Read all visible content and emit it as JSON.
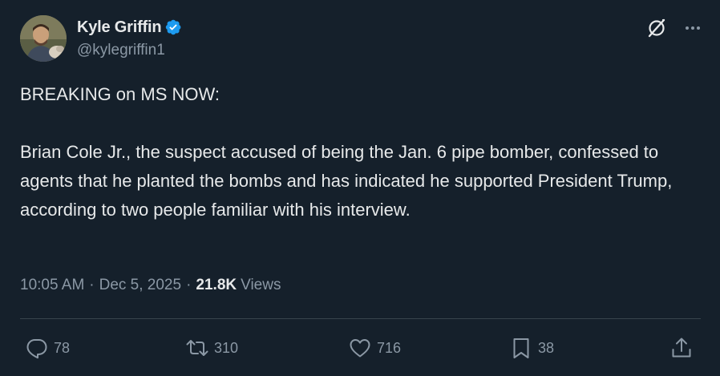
{
  "author": {
    "display_name": "Kyle Griffin",
    "handle": "@kylegriffin1",
    "verified": true,
    "verified_color": "#1d9bf0"
  },
  "header_icons": [
    "grok-icon",
    "more-icon"
  ],
  "tweet": {
    "text": "BREAKING on MS NOW:\n\nBrian Cole Jr., the suspect accused of being the Jan. 6 pipe bomber, confessed to agents that he planted the bombs and has indicated he supported President Trump, according to two people familiar with his interview."
  },
  "meta": {
    "time": "10:05 AM",
    "separator": "·",
    "date": "Dec 5, 2025",
    "views_count": "21.8K",
    "views_label": "Views"
  },
  "actions": {
    "reply": {
      "icon": "reply-icon",
      "count": "78"
    },
    "repost": {
      "icon": "repost-icon",
      "count": "310"
    },
    "like": {
      "icon": "like-icon",
      "count": "716"
    },
    "bookmark": {
      "icon": "bookmark-icon",
      "count": "38"
    },
    "share": {
      "icon": "share-icon"
    }
  },
  "colors": {
    "background": "#15202b",
    "primary_text": "#e7e9ea",
    "secondary_text": "#8b98a5",
    "divider": "#38444d"
  }
}
